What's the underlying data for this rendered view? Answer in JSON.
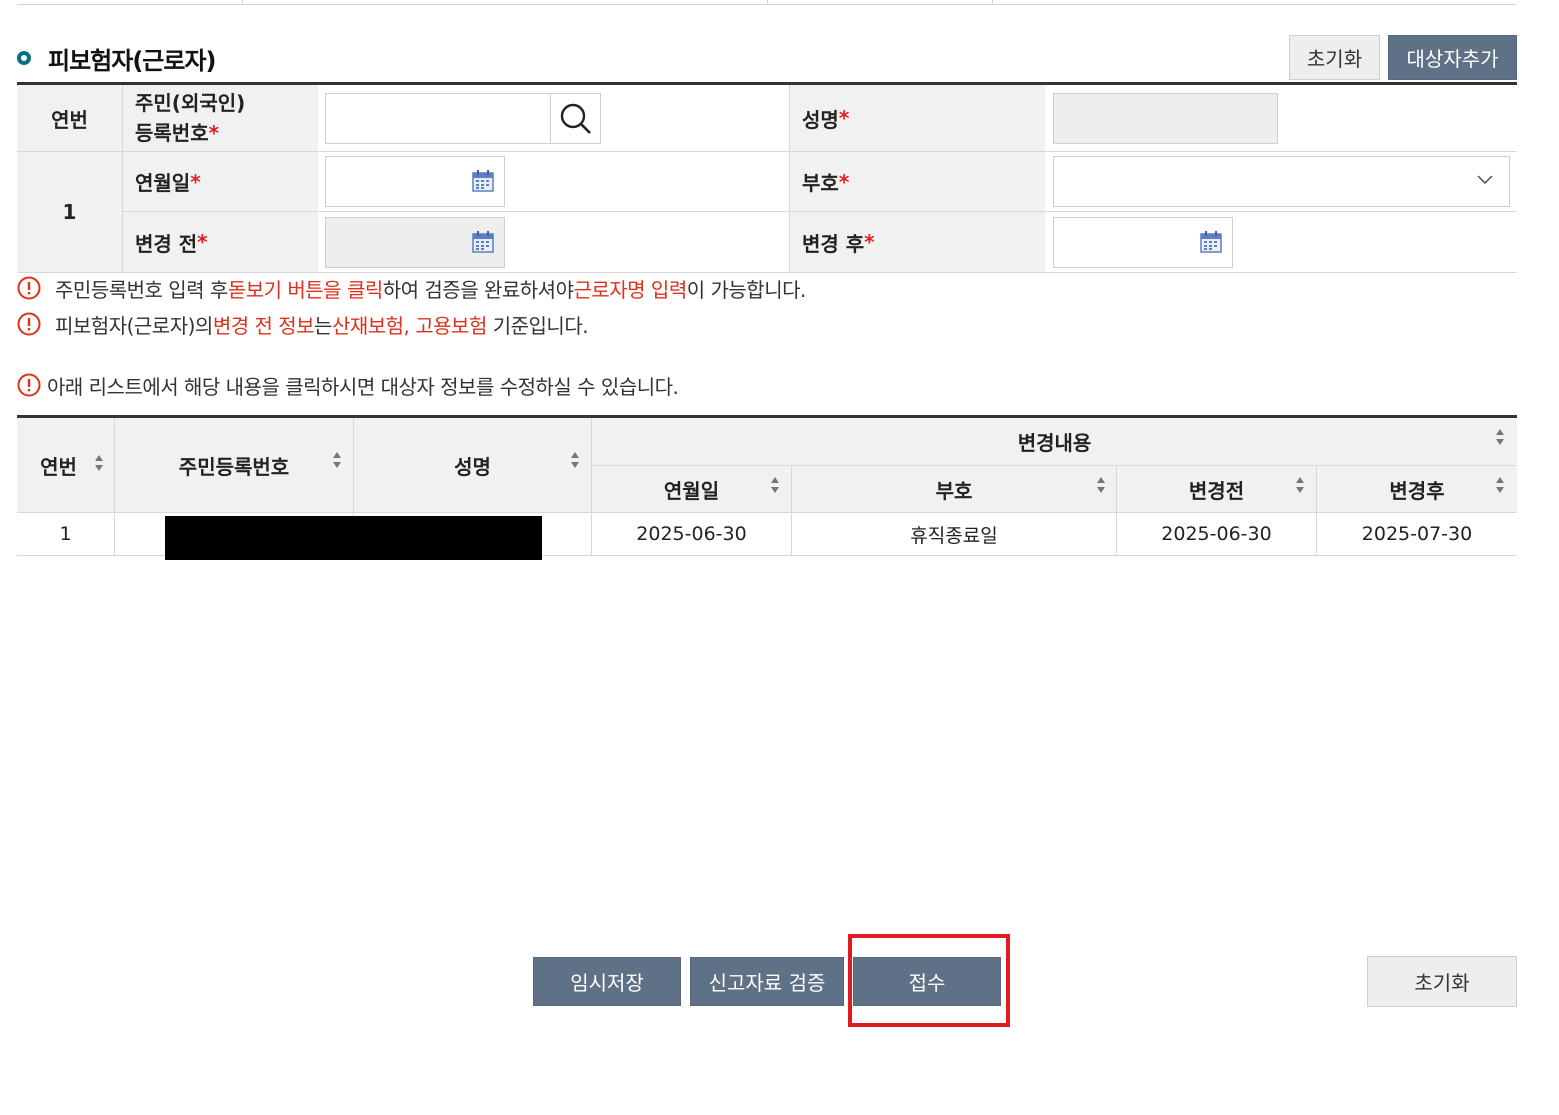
{
  "section": {
    "title": "피보험자(근로자)",
    "reset_label": "초기화",
    "add_label": "대상자추가"
  },
  "form": {
    "seq_label": "연번",
    "seq_value": "1",
    "rrn_label_line1": "주민(외국인)",
    "rrn_label_line2": "등록번호",
    "name_label": "성명",
    "date_label": "연월일",
    "code_label": "부호 ",
    "before_label": "변경 전",
    "after_label": "변경 후",
    "required_mark": "*",
    "rrn_value": "",
    "name_value": "",
    "date_value": "",
    "code_value": "",
    "before_value": "",
    "after_value": ""
  },
  "notices": {
    "n1": {
      "a": "주민등록번호 입력 후 ",
      "b": "돋보기 버튼을 클릭",
      "c": "하여 검증을 완료하셔야 ",
      "d": "근로자명 입력",
      "e": "이 가능합니다."
    },
    "n2": {
      "a": "피보험자(근로자)의 ",
      "b": "변경 전 정보",
      "c": "는 ",
      "d": "산재보험, 고용보험",
      "e": " 기준입니다."
    },
    "n3": "아래 리스트에서 해당 내용을 클릭하시면 대상자 정보를 수정하실 수 있습니다."
  },
  "list": {
    "headers": {
      "seq": "연번",
      "rrn": "주민등록번호",
      "name": "성명",
      "change": "변경내용",
      "date": "연월일",
      "code": "부호",
      "before": "변경전",
      "after": "변경후"
    },
    "rows": [
      {
        "seq": "1",
        "rrn": "",
        "name": "",
        "date": "2025-06-30",
        "code": "휴직종료일",
        "before": "2025-06-30",
        "after": "2025-07-30"
      }
    ]
  },
  "actions": {
    "temp_save": "임시저장",
    "validate": "신고자료 검증",
    "submit": "접수",
    "reset": "초기화"
  },
  "colors": {
    "accent": "#5f7187",
    "required": "#e02020",
    "highlight_box": "#e01b22",
    "notice_red": "#e0301c"
  }
}
